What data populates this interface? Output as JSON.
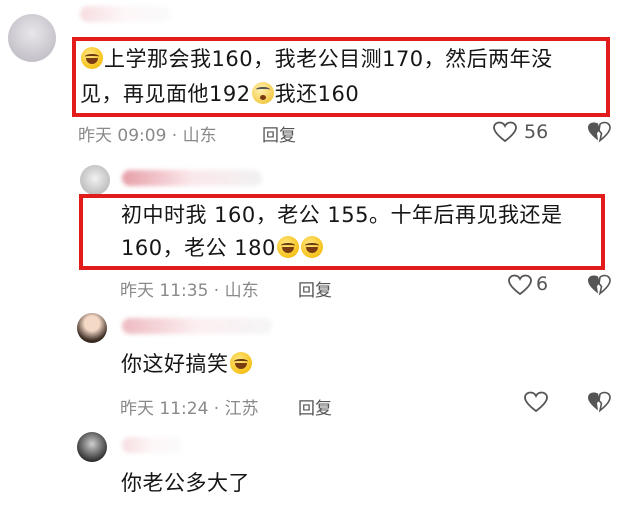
{
  "comments": [
    {
      "text_line1": "上学那会我160，我老公目测170，然后两年没",
      "text_line2_a": "见，再见面他192",
      "text_line2_b": "我还160",
      "emoji_lead": "grinning-squint-tears",
      "emoji_mid": "pleading-face",
      "time": "昨天 09:09 · 山东",
      "reply_label": "回复",
      "like_count": "56"
    },
    {
      "text_line1": "初中时我 160，老公 155。十年后再见我还是",
      "text_line2": "160，老公 180",
      "emoji_end": "grinning-squint-tears x2",
      "time": "昨天 11:35 · 山东",
      "reply_label": "回复",
      "like_count": "6"
    },
    {
      "text": "你这好搞笑",
      "emoji_end": "grinning-squint-tears",
      "time": "昨天 11:24 · 江苏",
      "reply_label": "回复"
    },
    {
      "text": "你老公多大了"
    }
  ],
  "colors": {
    "highlight": "#e21b1b",
    "meta": "#8a8a8a",
    "text": "#161616"
  }
}
